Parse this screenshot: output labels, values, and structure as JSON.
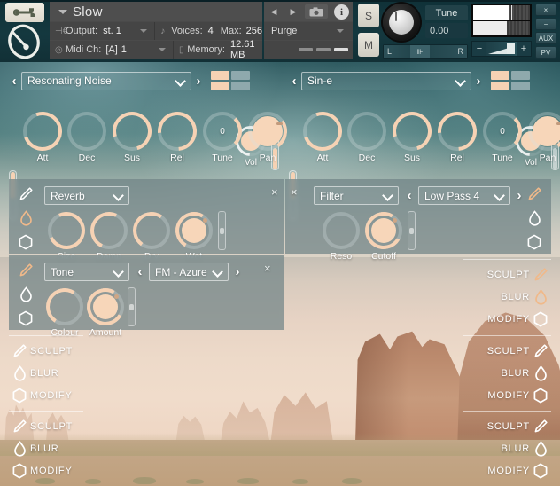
{
  "app": {
    "title": "Slow",
    "wrench_icon": "wrench-icon",
    "logo_icon": "kontakt-logo-icon"
  },
  "header": {
    "instrument_name": "Slow",
    "output_label": "Output:",
    "output_value": "st. 1",
    "midi_label": "Midi Ch:",
    "midi_bracket": "[A]",
    "midi_value": "1",
    "voices_label": "Voices:",
    "voices_value": "4",
    "max_label": "Max:",
    "max_value": "256",
    "memory_label": "Memory:",
    "memory_value": "12.61 MB",
    "purge_label": "Purge",
    "prev_arrow": "◀",
    "next_arrow": "▶",
    "camera_icon": "camera-icon",
    "info_icon": "info-icon",
    "solo_label": "S",
    "mute_label": "M",
    "tune_label": "Tune",
    "tune_value": "0.00",
    "pan_left": "L",
    "pan_right": "R",
    "pan_center_icon": "pan-center-icon",
    "volume_minus": "−",
    "volume_plus": "+",
    "right_buttons": [
      "×",
      "−",
      "AUX",
      "PV"
    ]
  },
  "sources": [
    {
      "id": "source-left",
      "name": "Resonating Noise",
      "prev_arrow": "‹",
      "next_arrow": "›",
      "vol_label": "Vol",
      "knobs": [
        {
          "label": "Att",
          "value": "",
          "pct": 72
        },
        {
          "label": "Dec",
          "value": "",
          "pct": 0
        },
        {
          "label": "Sus",
          "value": "",
          "pct": 88
        },
        {
          "label": "Rel",
          "value": "",
          "pct": 76
        },
        {
          "label": "Tune",
          "value": "0",
          "pct": 50
        },
        {
          "label": "Pan",
          "value": "",
          "pct": 50
        }
      ]
    },
    {
      "id": "source-right",
      "name": "Sin-e",
      "prev_arrow": "‹",
      "next_arrow": "›",
      "vol_label": "Vol",
      "knobs": [
        {
          "label": "Att",
          "value": "",
          "pct": 72
        },
        {
          "label": "Dec",
          "value": "",
          "pct": 0
        },
        {
          "label": "Sus",
          "value": "",
          "pct": 88
        },
        {
          "label": "Rel",
          "value": "",
          "pct": 76
        },
        {
          "label": "Tune",
          "value": "0",
          "pct": 50
        },
        {
          "label": "Pan",
          "value": "",
          "pct": 50
        }
      ]
    }
  ],
  "fx_panels": [
    {
      "id": "fx-reverb",
      "type_value": "Reverb",
      "preset_value": null,
      "close_label": "×",
      "tools": [
        "sculpt-pencil-icon",
        "blur-drop-icon",
        "modify-hex-icon"
      ],
      "active_tool": "blur-drop-icon",
      "knobs": [
        {
          "label": "Size",
          "pct": 80,
          "filled": false
        },
        {
          "label": "Damp",
          "pct": 72,
          "filled": false
        },
        {
          "label": "Dry",
          "pct": 58,
          "filled": false
        },
        {
          "label": "Wet",
          "pct": 62,
          "filled": true
        }
      ]
    },
    {
      "id": "fx-filter",
      "type_value": "Filter",
      "preset_value": "Low Pass 4",
      "preset_prev": "‹",
      "preset_next": "›",
      "close_label": "×",
      "tools": [
        "sculpt-pencil-icon",
        "blur-drop-icon",
        "modify-hex-icon"
      ],
      "active_tool": "sculpt-pencil-icon",
      "knobs": [
        {
          "label": "Reso",
          "pct": 0,
          "filled": false
        },
        {
          "label": "Cutoff",
          "pct": 60,
          "filled": true
        }
      ]
    },
    {
      "id": "fx-tone",
      "type_value": "Tone",
      "preset_value": "FM - Azure",
      "preset_prev": "‹",
      "preset_next": "›",
      "close_label": "×",
      "tools": [
        "sculpt-pencil-icon",
        "blur-drop-icon",
        "modify-hex-icon"
      ],
      "active_tool": "sculpt-pencil-icon",
      "knobs": [
        {
          "label": "Colour",
          "pct": 62,
          "filled": false
        },
        {
          "label": "Amount",
          "pct": 70,
          "filled": true
        }
      ]
    }
  ],
  "slot_stacks": {
    "left": [
      {
        "rows": [
          {
            "label": "SCULPT",
            "icon": "sculpt-pencil-icon"
          },
          {
            "label": "BLUR",
            "icon": "blur-drop-icon"
          },
          {
            "label": "MODIFY",
            "icon": "modify-hex-icon"
          }
        ]
      },
      {
        "rows": [
          {
            "label": "SCULPT",
            "icon": "sculpt-pencil-icon"
          },
          {
            "label": "BLUR",
            "icon": "blur-drop-icon"
          },
          {
            "label": "MODIFY",
            "icon": "modify-hex-icon"
          }
        ]
      }
    ],
    "right": [
      {
        "rows": [
          {
            "label": "SCULPT",
            "icon": "sculpt-pencil-icon"
          },
          {
            "label": "BLUR",
            "icon": "blur-drop-icon"
          },
          {
            "label": "MODIFY",
            "icon": "modify-hex-icon"
          }
        ]
      },
      {
        "rows": [
          {
            "label": "SCULPT",
            "icon": "sculpt-pencil-icon"
          },
          {
            "label": "BLUR",
            "icon": "blur-drop-icon"
          },
          {
            "label": "MODIFY",
            "icon": "modify-hex-icon"
          }
        ]
      },
      {
        "rows": [
          {
            "label": "SCULPT",
            "icon": "sculpt-pencil-icon"
          },
          {
            "label": "BLUR",
            "icon": "blur-drop-icon"
          },
          {
            "label": "MODIFY",
            "icon": "modify-hex-icon"
          }
        ]
      }
    ]
  },
  "colors": {
    "accent_peach": "#f6d2b4",
    "panel_bg": "rgba(112,132,134,0.72)",
    "header_dark": "#123036",
    "kontakt_gray": "#4a4a4a",
    "text_white": "#ffffff"
  }
}
